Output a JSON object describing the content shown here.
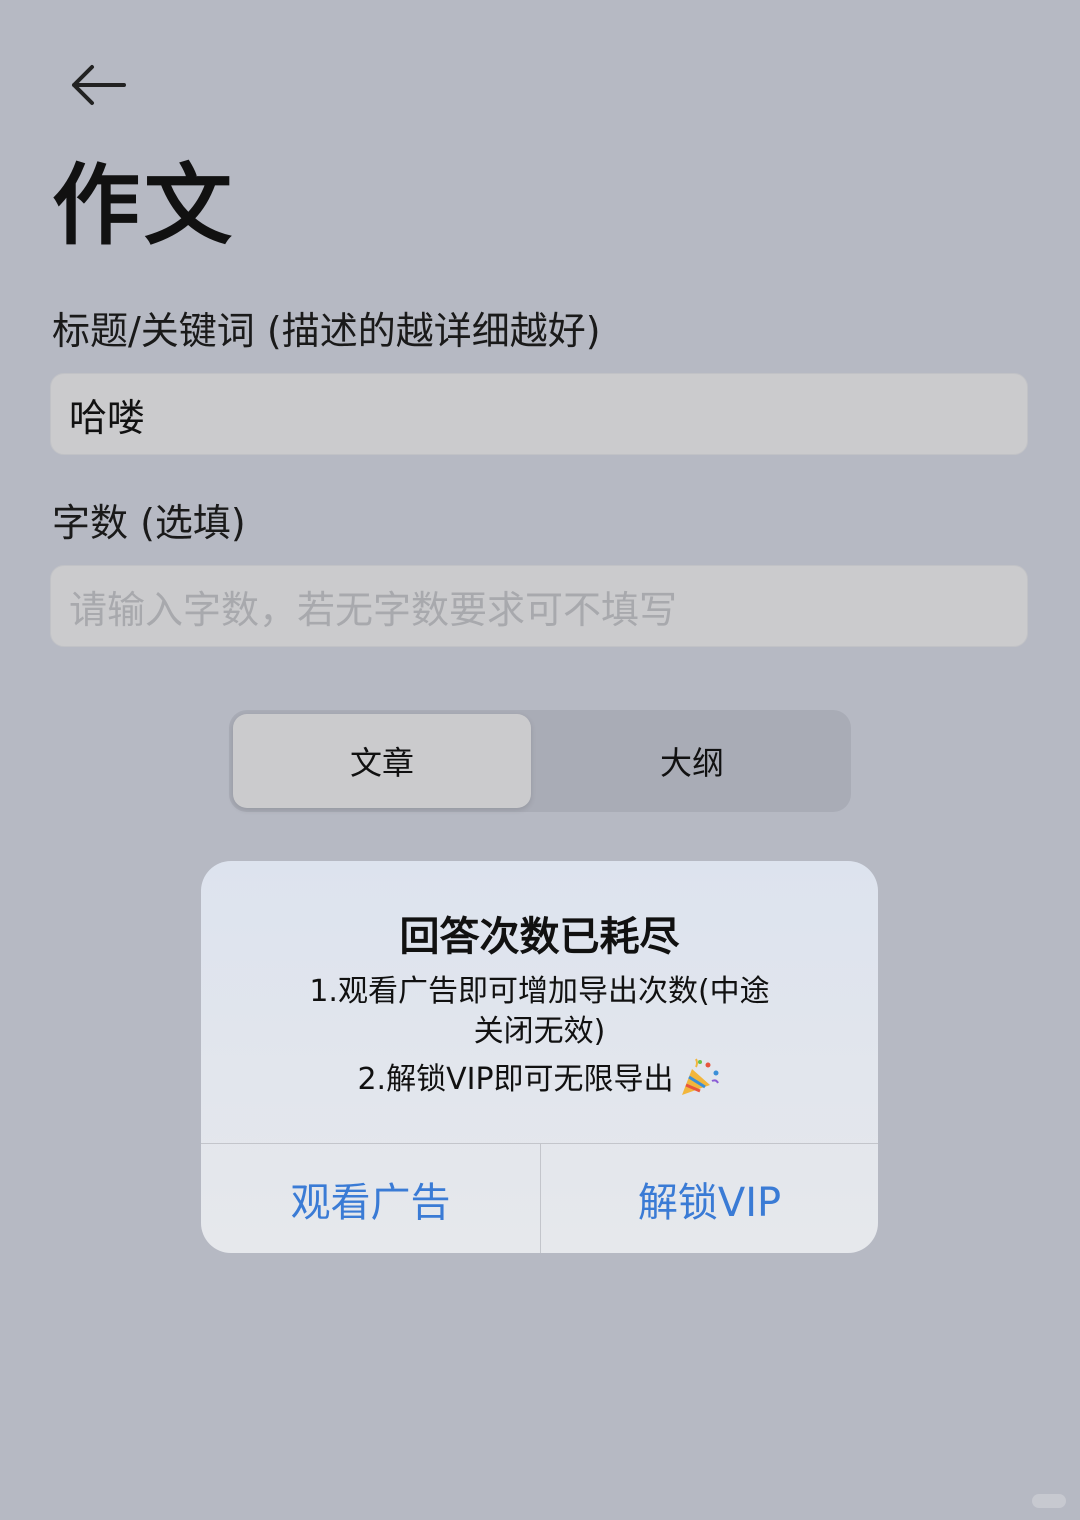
{
  "header": {
    "back_icon": "arrow-left-icon",
    "title": "作文"
  },
  "form": {
    "title_label": "标题/关键词 (描述的越详细越好)",
    "title_value": "哈喽",
    "count_label": "字数 (选填)",
    "count_placeholder": "请输入字数，若无字数要求可不填写"
  },
  "segmented": {
    "options": [
      "文章",
      "大纲"
    ],
    "selected": "文章"
  },
  "dialog": {
    "title": "回答次数已耗尽",
    "line1": "1.观看广告即可增加导出次数(中途",
    "line2": "关闭无效)",
    "line3": "2.解锁VIP即可无限导出",
    "line3_icon": "party-popper-icon",
    "buttons": {
      "watch_ad": "观看广告",
      "unlock_vip": "解锁VIP"
    }
  },
  "colors": {
    "background": "#b6b9c3",
    "input_bg": "#cbcbcd",
    "dialog_bg": "#e4e7ed",
    "accent_blue": "#3a7bd5"
  }
}
